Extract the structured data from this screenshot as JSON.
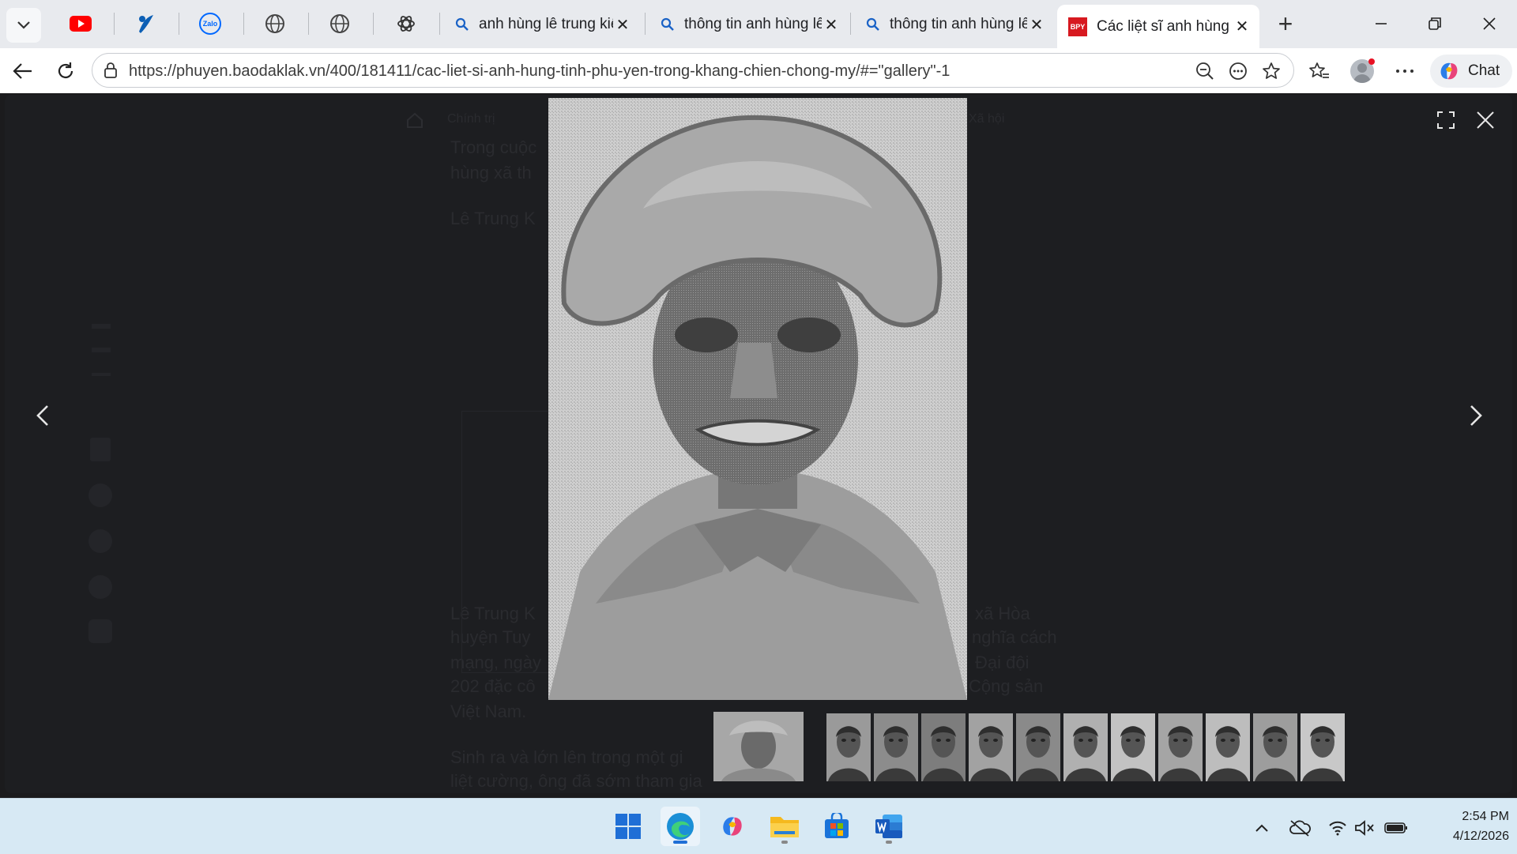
{
  "browser": {
    "tabs": [
      {
        "title": "anh hùng lê trung kiên",
        "icon": "search-icon",
        "active": false
      },
      {
        "title": "thông tin anh hùng lê",
        "icon": "search-icon",
        "active": false
      },
      {
        "title": "thông tin anh hùng lê",
        "icon": "search-icon",
        "active": false
      },
      {
        "title": "Các liệt sĩ anh hùng tỉnh",
        "icon": "bpy-favicon",
        "favicon_text": "BPY",
        "active": true
      }
    ],
    "pinned_tabs": [
      "youtube-icon",
      "vnpt-icon",
      "zalo-icon",
      "globe-icon",
      "globe-icon",
      "chatgpt-icon"
    ],
    "zalo_label": "Zalo",
    "url": "https://phuyen.baodaklak.vn/400/181411/cac-liet-si-anh-hung-tinh-phu-yen-trong-khang-chien-chong-my/#=\"gallery\"-1",
    "chat_label": "Chat",
    "colors": {
      "youtube": "#ff0000",
      "bpy": "#d71920",
      "accent": "#0a66c2"
    }
  },
  "background_article": {
    "nav_items": [
      "Chính trị",
      "Xã hội"
    ],
    "lines": [
      "Trong cuộc",
      "hùng xã th",
      "Lê Trung K",
      "Lê Trung K",
      "huyện Tuy",
      "mạng, ngày",
      "202 đặc cô",
      "Việt Nam.",
      "Sinh ra và lớn lên trong một gi",
      "liệt cường, ông đã sớm tham gia"
    ],
    "right_fragments": [
      "xã Hòa",
      "nghĩa cách",
      "Đại đội",
      "Cộng sản"
    ]
  },
  "gallery": {
    "thumbnail_count": 12,
    "active_index": 0
  },
  "taskbar": {
    "apps": [
      "windows-start-icon",
      "edge-icon",
      "copilot-icon",
      "file-explorer-icon",
      "microsoft-store-icon",
      "word-icon"
    ],
    "time": "2:54 PM",
    "date": "4/12/2026"
  }
}
